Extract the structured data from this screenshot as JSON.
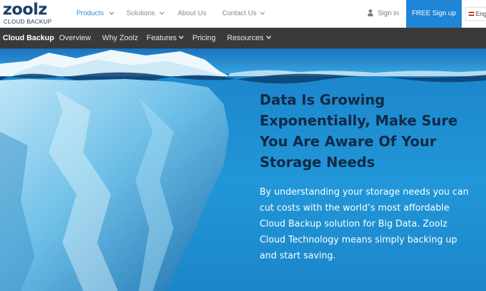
{
  "brand": {
    "logo_word": "zoolz",
    "logo_sub": "CLOUD BACKUP"
  },
  "topnav": {
    "items": [
      {
        "label": "Products",
        "active": true
      },
      {
        "label": "Solutions"
      },
      {
        "label": "About Us"
      },
      {
        "label": "Contact Us"
      }
    ],
    "signin_label": "Sign in",
    "signup_label": "FREE Sign up",
    "language_label": "Eng"
  },
  "subnav": {
    "brand": "Cloud Backup",
    "items": [
      {
        "label": "Overview"
      },
      {
        "label": "Why Zoolz"
      },
      {
        "label": "Features"
      },
      {
        "label": "Pricing"
      },
      {
        "label": "Resources"
      }
    ]
  },
  "hero": {
    "headline": "Data Is Growing Exponentially, Make Sure You Are Aware Of Your Storage Needs",
    "body": "By understanding your storage needs you can cut costs with the world’s most affordable Cloud Backup solution for Big Data. Zoolz Cloud Technology means simply backing up and start saving."
  },
  "colors": {
    "accent": "#1f85d6",
    "nav_active": "#2f8fd0",
    "subnav_bg": "#3a3a3a",
    "headline": "#0f2a45",
    "ocean": "#1c8fd3"
  }
}
